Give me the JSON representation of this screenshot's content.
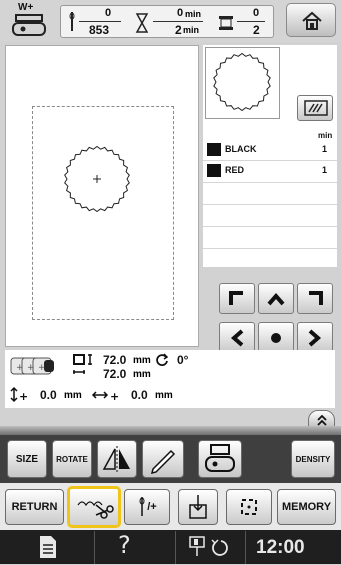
{
  "header": {
    "stitch_current": "0",
    "stitch_total": "853",
    "time_current": "0",
    "time_unit_1": "min",
    "time_total": "2",
    "time_unit_2": "min",
    "color_current": "0",
    "color_total": "2",
    "wplus_label": "W+"
  },
  "thread_list": {
    "header": "min",
    "rows": [
      {
        "name": "BLACK",
        "minutes": "1",
        "swatch": "#111111"
      },
      {
        "name": "RED",
        "minutes": "1",
        "swatch": "#111111"
      }
    ]
  },
  "info": {
    "width": "72.0",
    "height": "72.0",
    "unit": "mm",
    "rotation": "0°",
    "offset_v": "0.0",
    "offset_h": "0.0"
  },
  "toolbar": {
    "size_label": "SIZE",
    "rotate_label": "ROTATE",
    "density_label": "DENSITY"
  },
  "bottom": {
    "return_label": "RETURN",
    "thread_label": "/+",
    "memory_label": "MEMORY"
  },
  "status": {
    "help_label": "?",
    "clock": "12:00"
  },
  "colors": {
    "highlight": "#f0c419",
    "dark_bar": "#1f1f1f"
  }
}
